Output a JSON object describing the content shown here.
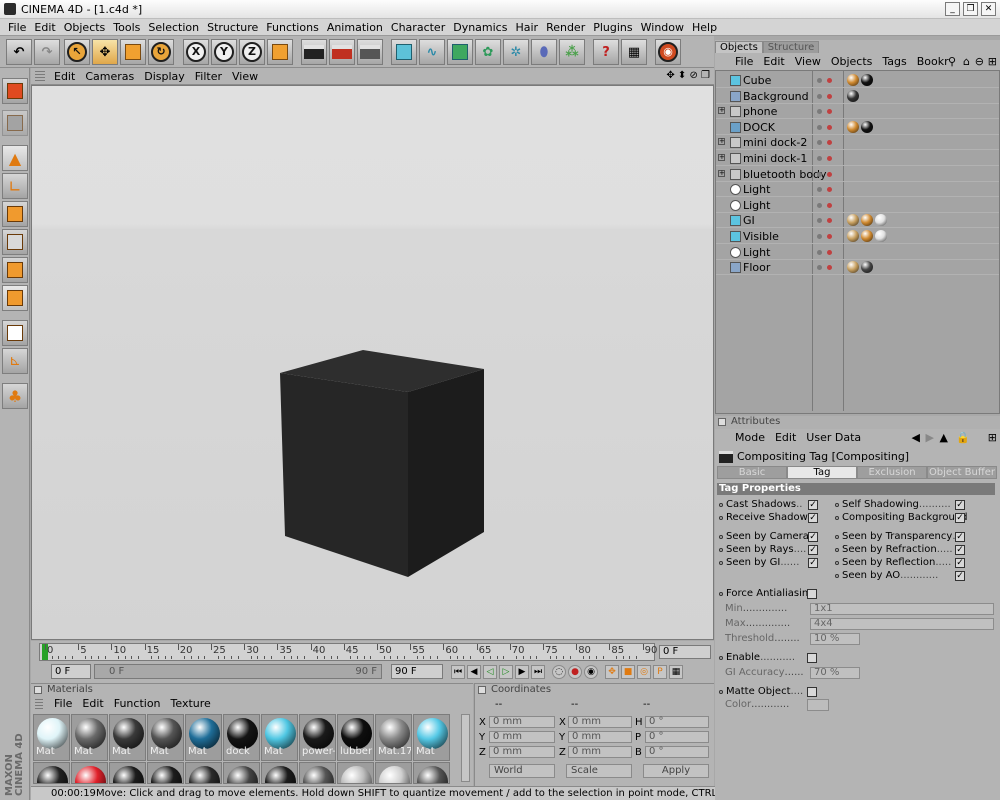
{
  "window": {
    "title": "CINEMA 4D - [1.c4d *]",
    "buttons": [
      "_",
      "❐",
      "✕"
    ]
  },
  "menubar": [
    "File",
    "Edit",
    "Objects",
    "Tools",
    "Selection",
    "Structure",
    "Functions",
    "Animation",
    "Character",
    "Dynamics",
    "Hair",
    "Render",
    "Plugins",
    "Window",
    "Help"
  ],
  "toolbar": {
    "x_label": "X",
    "y_label": "Y",
    "z_label": "Z",
    "help": "?"
  },
  "viewport": {
    "menu": [
      "Edit",
      "Cameras",
      "Display",
      "Filter",
      "View"
    ],
    "nav_icons": "✥ ⬍ ⊘ ❐"
  },
  "timeline": {
    "ticks": [
      "0",
      "5",
      "10",
      "15",
      "20",
      "25",
      "30",
      "35",
      "40",
      "45",
      "50",
      "55",
      "60",
      "65",
      "70",
      "75",
      "80",
      "85",
      "90"
    ],
    "current_frame": "0 F",
    "start_field": "0 F",
    "range_left": "0 F",
    "range_right": "90 F",
    "end_field": "90 F"
  },
  "materials": {
    "header": "Materials",
    "menu": [
      "File",
      "Edit",
      "Function",
      "Texture"
    ],
    "row1": [
      {
        "label": "Mat",
        "color": "#dff4f8"
      },
      {
        "label": "Mat",
        "color": "#6a6a6a"
      },
      {
        "label": "Mat",
        "color": "#3a3a3a"
      },
      {
        "label": "Mat",
        "color": "#555555"
      },
      {
        "label": "Mat",
        "color": "#1f6e99"
      },
      {
        "label": "dock",
        "color": "#151515"
      },
      {
        "label": "Mat",
        "color": "#4fc7e3"
      },
      {
        "label": "power-",
        "color": "#1a1a1a"
      },
      {
        "label": "lubber",
        "color": "#0e0e0e"
      },
      {
        "label": "Mat.17",
        "color": "#8a8a8a"
      },
      {
        "label": "Mat",
        "color": "#55c9e6"
      }
    ],
    "row2": [
      "#222222",
      "#e0202a",
      "#1c1c1c",
      "#1c1c1c",
      "#2a2a2a",
      "#444444",
      "#1c1c1c",
      "#555555",
      "#bdbdbd",
      "#cfcfcf",
      "#555555"
    ]
  },
  "coordinates": {
    "header": "Coordinates",
    "col_headers": [
      "--",
      "--",
      "--"
    ],
    "rows": [
      {
        "a": "X",
        "a_val": "0 mm",
        "b": "X",
        "b_val": "0 mm",
        "c": "H",
        "c_val": "0 °"
      },
      {
        "a": "Y",
        "a_val": "0 mm",
        "b": "Y",
        "b_val": "0 mm",
        "c": "P",
        "c_val": "0 °"
      },
      {
        "a": "Z",
        "a_val": "0 mm",
        "b": "Z",
        "b_val": "0 mm",
        "c": "B",
        "c_val": "0 °"
      }
    ],
    "world": "World",
    "scale": "Scale",
    "apply": "Apply"
  },
  "status": {
    "time": "00:00:19",
    "message": "Move: Click and drag to move elements. Hold down SHIFT to quantize movement / add to the selection in point mode, CTRL to remove."
  },
  "objects": {
    "tabs": [
      "Objects",
      "Structure"
    ],
    "menu": [
      "File",
      "Edit",
      "View",
      "Objects",
      "Tags",
      "Bookr"
    ],
    "items": [
      {
        "name": "Cube",
        "icon": "#5cc4e0",
        "expand": "",
        "tags": [
          "#d08a30",
          "#111111"
        ]
      },
      {
        "name": "Background",
        "icon": "#8aa6c8",
        "expand": "",
        "tags": [
          "#333333"
        ]
      },
      {
        "name": "phone",
        "icon": "#c8c8c8",
        "expand": "+",
        "tags": []
      },
      {
        "name": "DOCK",
        "icon": "#6aa0c8",
        "expand": "",
        "tags": [
          "#d08a30",
          "#111111"
        ]
      },
      {
        "name": "mini dock-2",
        "icon": "#c8c8c8",
        "expand": "+",
        "tags": []
      },
      {
        "name": "mini dock-1",
        "icon": "#c8c8c8",
        "expand": "+",
        "tags": []
      },
      {
        "name": "bluetooth body",
        "icon": "#c8c8c8",
        "expand": "+",
        "tags": []
      },
      {
        "name": "Light",
        "icon": "#ffffff",
        "expand": "",
        "tags": []
      },
      {
        "name": "Light",
        "icon": "#ffffff",
        "expand": "",
        "tags": []
      },
      {
        "name": "GI",
        "icon": "#5cc4e0",
        "expand": "",
        "tags": [
          "#c8a060",
          "#d08a30",
          "#e0e0e0"
        ]
      },
      {
        "name": "Visible",
        "icon": "#5cc4e0",
        "expand": "",
        "tags": [
          "#c8a060",
          "#d08a30",
          "#e0e0e0"
        ]
      },
      {
        "name": "Light",
        "icon": "#ffffff",
        "expand": "",
        "tags": []
      },
      {
        "name": "Floor",
        "icon": "#8aa6c8",
        "expand": "",
        "tags": [
          "#c8a060",
          "#444444"
        ]
      }
    ]
  },
  "attributes": {
    "header": "Attributes",
    "menu": [
      "Mode",
      "Edit",
      "User Data"
    ],
    "title": "Compositing Tag [Compositing]",
    "tabs": [
      "Basic",
      "Tag",
      "Exclusion",
      "Object Buffer"
    ],
    "section": "Tag Properties",
    "left": [
      {
        "label": "Cast Shadows",
        "dots": "..",
        "checked": "✓"
      },
      {
        "label": "Receive Shadows",
        "dots": "",
        "checked": "✓"
      },
      {
        "label": "Seen by Camera",
        "dots": "...",
        "checked": "✓"
      },
      {
        "label": "Seen by Rays",
        "dots": "....",
        "checked": "✓"
      },
      {
        "label": "Seen by GI",
        "dots": "......",
        "checked": "✓"
      }
    ],
    "right": [
      {
        "label": "Self Shadowing",
        "dots": "..........",
        "checked": "✓"
      },
      {
        "label": "Compositing Background",
        "dots": "",
        "checked": "✓"
      },
      {
        "label": "Seen by Transparency",
        "dots": "..",
        "checked": "✓"
      },
      {
        "label": "Seen by Refraction",
        "dots": ".....",
        "checked": "✓"
      },
      {
        "label": "Seen by Reflection",
        "dots": ".....",
        "checked": "✓"
      },
      {
        "label": "Seen by AO",
        "dots": "............",
        "checked": "✓"
      }
    ],
    "force_aa": {
      "label": "Force Antialiasing",
      "checked": ""
    },
    "min": {
      "label": "Min",
      "dots": "..............",
      "value": "1x1"
    },
    "max": {
      "label": "Max",
      "dots": "..............",
      "value": "4x4"
    },
    "threshold": {
      "label": "Threshold",
      "dots": "........",
      "value": "10 %"
    },
    "enable": {
      "label": "Enable",
      "dots": "...........",
      "checked": ""
    },
    "gi_accuracy": {
      "label": "GI Accuracy",
      "dots": "......",
      "value": "70 %"
    },
    "matte": {
      "label": "Matte Object",
      "dots": "....",
      "checked": ""
    },
    "color": {
      "label": "Color",
      "dots": "............"
    }
  }
}
